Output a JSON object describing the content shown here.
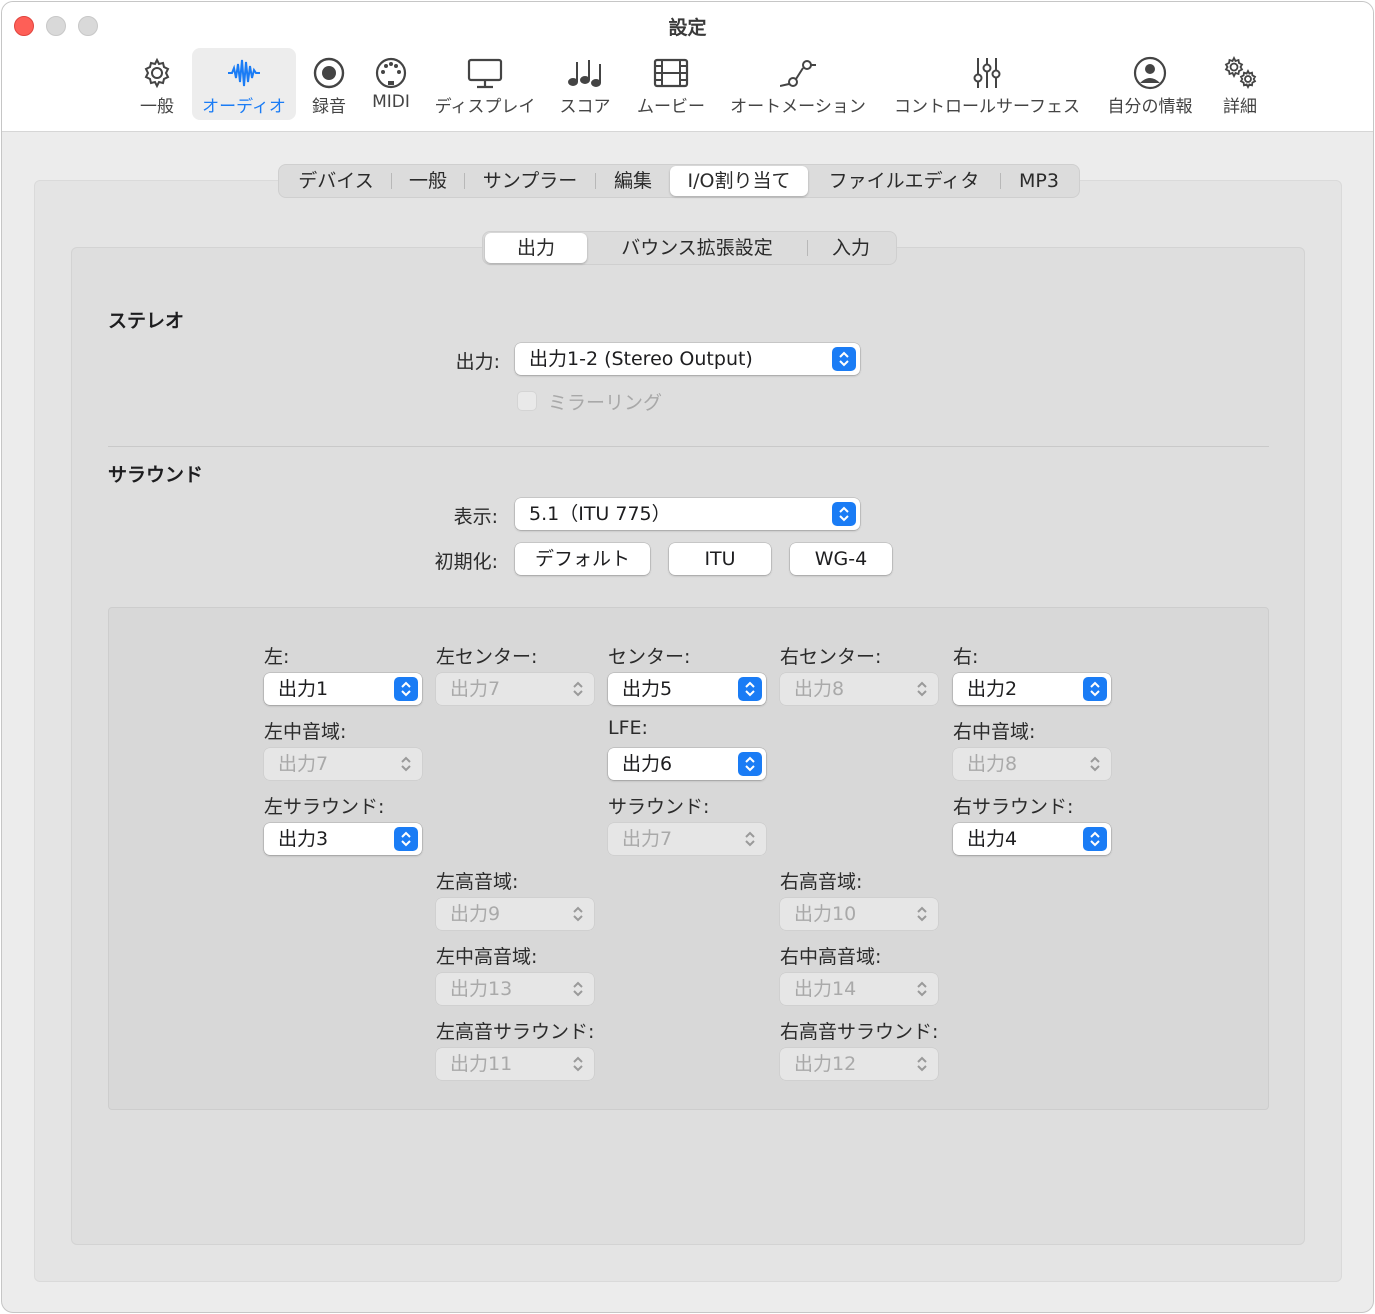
{
  "window": {
    "title": "設定"
  },
  "toolbar": {
    "items": [
      {
        "label": "一般",
        "icon": "gear-icon"
      },
      {
        "label": "オーディオ",
        "icon": "waveform-icon",
        "active": true
      },
      {
        "label": "録音",
        "icon": "record-icon"
      },
      {
        "label": "MIDI",
        "icon": "midi-port-icon"
      },
      {
        "label": "ディスプレイ",
        "icon": "display-icon"
      },
      {
        "label": "スコア",
        "icon": "music-notes-icon"
      },
      {
        "label": "ムービー",
        "icon": "film-icon"
      },
      {
        "label": "オートメーション",
        "icon": "automation-curve-icon"
      },
      {
        "label": "コントロールサーフェス",
        "icon": "faders-icon"
      },
      {
        "label": "自分の情報",
        "icon": "user-circle-icon"
      },
      {
        "label": "詳細",
        "icon": "gears-icon"
      }
    ],
    "accent": "#1a7cf5"
  },
  "tabs": {
    "items": [
      "デバイス",
      "一般",
      "サンプラー",
      "編集",
      "I/O割り当て",
      "ファイルエディタ",
      "MP3"
    ],
    "selected": "I/O割り当て"
  },
  "subtabs": {
    "items": [
      "出力",
      "バウンス拡張設定",
      "入力"
    ],
    "selected": "出力"
  },
  "stereo": {
    "title": "ステレオ",
    "output_label": "出力:",
    "output_value": "出力1-2 (Stereo Output)",
    "mirroring_label": "ミラーリング",
    "mirroring_checked": false
  },
  "surround": {
    "title": "サラウンド",
    "display_label": "表示:",
    "display_value": "5.1（ITU 775）",
    "init_label": "初期化:",
    "init_buttons": [
      "デフォルト",
      "ITU",
      "WG-4"
    ]
  },
  "channels": {
    "left": {
      "label": "左:",
      "value": "出力1",
      "enabled": true
    },
    "left_center": {
      "label": "左センター:",
      "value": "出力7",
      "enabled": false
    },
    "center": {
      "label": "センター:",
      "value": "出力5",
      "enabled": true
    },
    "right_center": {
      "label": "右センター:",
      "value": "出力8",
      "enabled": false
    },
    "right": {
      "label": "右:",
      "value": "出力2",
      "enabled": true
    },
    "left_mid": {
      "label": "左中音域:",
      "value": "出力7",
      "enabled": false
    },
    "lfe": {
      "label": "LFE:",
      "value": "出力6",
      "enabled": true
    },
    "right_mid": {
      "label": "右中音域:",
      "value": "出力8",
      "enabled": false
    },
    "left_surround": {
      "label": "左サラウンド:",
      "value": "出力3",
      "enabled": true
    },
    "surround": {
      "label": "サラウンド:",
      "value": "出力7",
      "enabled": false
    },
    "right_surround": {
      "label": "右サラウンド:",
      "value": "出力4",
      "enabled": true
    },
    "left_high": {
      "label": "左高音域:",
      "value": "出力9",
      "enabled": false
    },
    "right_high": {
      "label": "右高音域:",
      "value": "出力10",
      "enabled": false
    },
    "left_mid_high": {
      "label": "左中高音域:",
      "value": "出力13",
      "enabled": false
    },
    "right_mid_high": {
      "label": "右中高音域:",
      "value": "出力14",
      "enabled": false
    },
    "left_high_surround": {
      "label": "左高音サラウンド:",
      "value": "出力11",
      "enabled": false
    },
    "right_high_surround": {
      "label": "右高音サラウンド:",
      "value": "出力12",
      "enabled": false
    }
  }
}
